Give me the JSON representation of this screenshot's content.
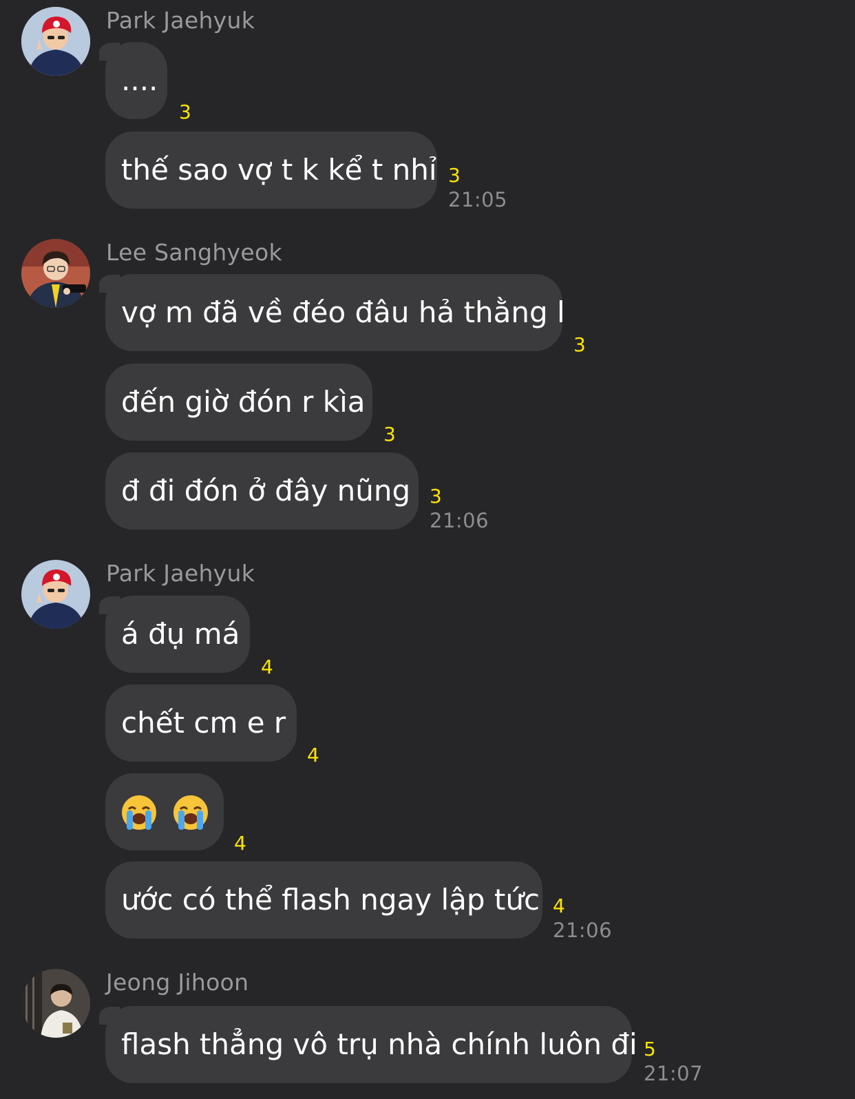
{
  "messages": [
    {
      "sender": "Park Jaehyuk",
      "avatar_icon": "avatar-park-jaehyuk",
      "bubbles": [
        {
          "text": "....",
          "unread": "3"
        },
        {
          "text": "thế sao vợ t k kể t nhỉ",
          "unread": "3",
          "time": "21:05"
        }
      ]
    },
    {
      "sender": "Lee Sanghyeok",
      "avatar_icon": "avatar-lee-sanghyeok",
      "bubbles": [
        {
          "text": "vợ m đã về đéo đâu hả thằng l",
          "unread": "3"
        },
        {
          "text": "đến giờ đón r kìa",
          "unread": "3"
        },
        {
          "text": "đ đi đón ở đây nũng",
          "unread": "3",
          "time": "21:06"
        }
      ]
    },
    {
      "sender": "Park Jaehyuk",
      "avatar_icon": "avatar-park-jaehyuk",
      "bubbles": [
        {
          "text": "á đụ má",
          "unread": "4"
        },
        {
          "text": "chết cm e r",
          "unread": "4"
        },
        {
          "emoji": [
            "loudly-crying-face-icon",
            "loudly-crying-face-icon"
          ],
          "unread": "4"
        },
        {
          "text": "ước có thể flash ngay lập tức",
          "unread": "4",
          "time": "21:06"
        }
      ]
    },
    {
      "sender": "Jeong Jihoon",
      "avatar_icon": "avatar-jeong-jihoon",
      "bubbles": [
        {
          "text": "flash thẳng vô trụ nhà chính luôn đi",
          "unread": "5",
          "time": "21:07"
        }
      ]
    }
  ],
  "colors": {
    "background": "#262628",
    "bubble": "#3b3b3e",
    "unread": "#ffe500",
    "sender": "#9a9a9e",
    "time": "#8d8d91"
  }
}
